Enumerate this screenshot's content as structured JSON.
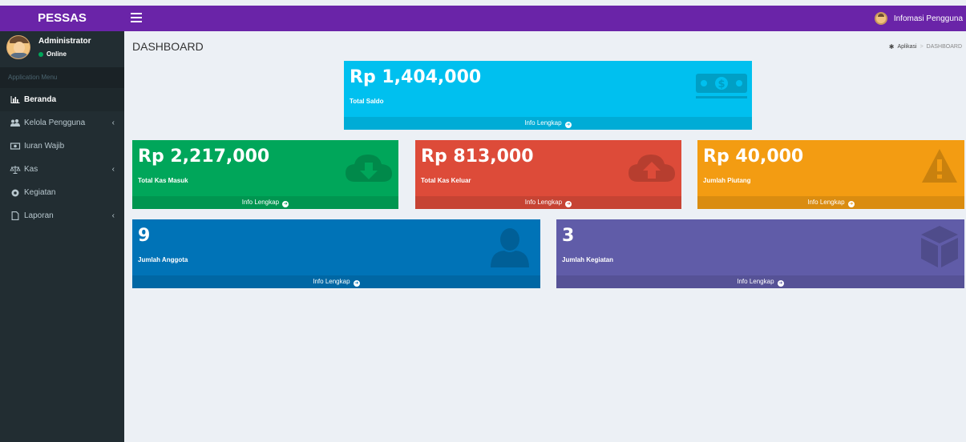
{
  "header": {
    "brand": "PESSAS",
    "user_menu_label": "Infomasi Pengguna"
  },
  "sidebar": {
    "user_name": "Administrator",
    "user_status": "Online",
    "menu_header": "Application Menu",
    "items": [
      {
        "label": "Beranda",
        "icon": "bar-chart-icon"
      },
      {
        "label": "Kelola Pengguna",
        "icon": "users-icon"
      },
      {
        "label": "Iuran Wajib",
        "icon": "money-icon"
      },
      {
        "label": "Kas",
        "icon": "balance-scale-icon"
      },
      {
        "label": "Kegiatan",
        "icon": "chrome-icon"
      },
      {
        "label": "Laporan",
        "icon": "file-icon"
      }
    ]
  },
  "content": {
    "title": "DASHBOARD",
    "breadcrumb": [
      "Aplikasi",
      "DASHBOARD"
    ]
  },
  "boxes": {
    "saldo": {
      "value": "Rp 1,404,000",
      "label": "Total Saldo",
      "footer": "Info Lengkap",
      "color": "#00c0ef"
    },
    "masuk": {
      "value": "Rp 2,217,000",
      "label": "Total Kas Masuk",
      "footer": "Info Lengkap",
      "color": "#00a65a"
    },
    "keluar": {
      "value": "Rp 813,000",
      "label": "Total Kas Keluar",
      "footer": "Info Lengkap",
      "color": "#dd4b39"
    },
    "piutang": {
      "value": "Rp 40,000",
      "label": "Jumlah Piutang",
      "footer": "Info Lengkap",
      "color": "#f39c12"
    },
    "anggota": {
      "value": "9",
      "label": "Jumlah Anggota",
      "footer": "Info Lengkap",
      "color": "#0073b7"
    },
    "kegiatan": {
      "value": "3",
      "label": "Jumlah Kegiatan",
      "footer": "Info Lengkap",
      "color": "#605ca8"
    }
  }
}
